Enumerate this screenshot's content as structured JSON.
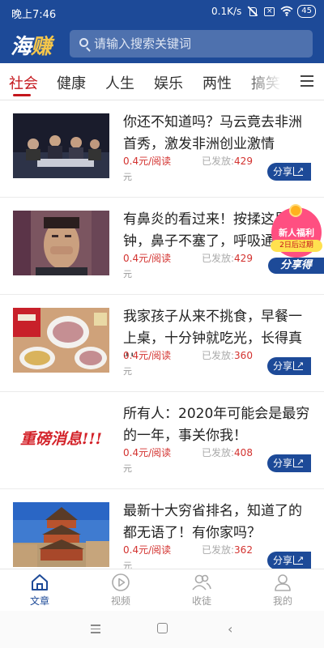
{
  "status_bar": {
    "time": "晚上7:46",
    "network_speed": "0.1K/s",
    "battery": "45"
  },
  "header": {
    "logo_first": "海",
    "logo_second": "赚",
    "search_placeholder": "请输入搜索关键词"
  },
  "tabs": [
    {
      "label": "社会",
      "active": true
    },
    {
      "label": "健康",
      "active": false
    },
    {
      "label": "人生",
      "active": false
    },
    {
      "label": "娱乐",
      "active": false
    },
    {
      "label": "两性",
      "active": false
    },
    {
      "label": "搞笑",
      "active": false
    }
  ],
  "articles": [
    {
      "title": "你还不知道吗？马云竟去非洲首秀，激发非洲创业激情",
      "price": "0.4元/阅读",
      "price_tail": "元",
      "sent_label": "已发放:",
      "sent_count": "429",
      "share_label": "分享"
    },
    {
      "title": "有鼻炎的看过来！按揉这里3分钟，鼻子不塞了，呼吸通畅",
      "price": "0.4元/阅读",
      "price_tail": "元",
      "sent_label": "已发放:",
      "sent_count": "429",
      "share_label": "分享"
    },
    {
      "title": "我家孩子从来不挑食，早餐一上桌，十分钟就吃光，长得真壮",
      "price": "0.4元/阅读",
      "price_tail": "元",
      "sent_label": "已发放:",
      "sent_count": "360",
      "share_label": "分享"
    },
    {
      "title": "所有人：2020年可能会是最穷的一年，事关你我！",
      "price": "0.4元/阅读",
      "price_tail": "元",
      "sent_label": "已发放:",
      "sent_count": "408",
      "share_label": "分享",
      "thumb_text": "重磅消息!!!"
    },
    {
      "title": "最新十大穷省排名，知道了的都无语了！有你家吗？",
      "price": "0.4元/阅读",
      "price_tail": "元",
      "sent_label": "已发放:",
      "sent_count": "362",
      "share_label": "分享"
    }
  ],
  "promo": {
    "title": "新人福利",
    "subtitle": "2日后过期",
    "button": "分享得"
  },
  "bottom_nav": [
    {
      "label": "文章",
      "icon": "home-icon",
      "active": true
    },
    {
      "label": "视频",
      "icon": "play-icon",
      "active": false
    },
    {
      "label": "收徒",
      "icon": "users-icon",
      "active": false
    },
    {
      "label": "我的",
      "icon": "user-icon",
      "active": false
    }
  ],
  "colors": {
    "brand_blue": "#1d4a98",
    "accent_red": "#c4161c",
    "price_red": "#d3322f",
    "promo_pink": "#ff4f81"
  }
}
